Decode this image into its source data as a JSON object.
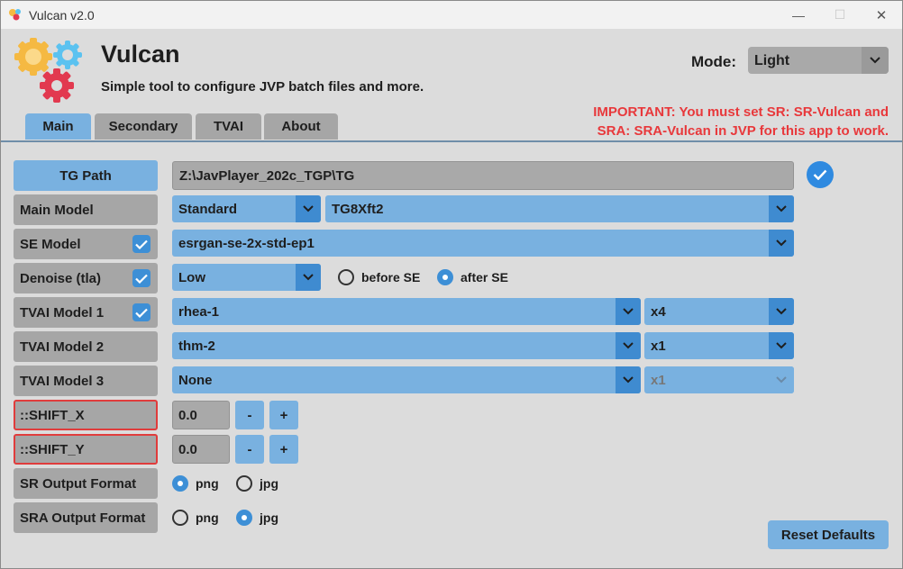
{
  "window": {
    "title": "Vulcan v2.0",
    "minimize": "—",
    "maximize": "☐",
    "close": "✕"
  },
  "header": {
    "app_name": "Vulcan",
    "subtitle": "Simple tool to configure JVP batch files and more.",
    "mode_label": "Mode:",
    "mode_value": "Light",
    "important_line1": "IMPORTANT: You must set SR: SR-Vulcan and",
    "important_line2": "SRA: SRA-Vulcan in JVP for this app to work.",
    "important_color": "#e8383b"
  },
  "tabs": [
    {
      "label": "Main",
      "active": true
    },
    {
      "label": "Secondary",
      "active": false
    },
    {
      "label": "TVAI",
      "active": false
    },
    {
      "label": "About",
      "active": false
    }
  ],
  "main": {
    "tg_path": {
      "label": "TG Path",
      "value": "Z:\\JavPlayer_202c_TGP\\TG",
      "status_icon": "check-circle-icon"
    },
    "main_model": {
      "label": "Main Model",
      "type": "Standard",
      "model": "TG8Xft2"
    },
    "se_model": {
      "label": "SE Model",
      "checked": true,
      "value": "esrgan-se-2x-std-ep1"
    },
    "denoise": {
      "label": "Denoise (tla)",
      "checked": true,
      "value": "Low",
      "before_label": "before SE",
      "after_label": "after SE",
      "selected": "after SE"
    },
    "tvai1": {
      "label": "TVAI Model 1",
      "checked": true,
      "model": "rhea-1",
      "scale": "x4"
    },
    "tvai2": {
      "label": "TVAI Model 2",
      "model": "thm-2",
      "scale": "x1"
    },
    "tvai3": {
      "label": "TVAI Model 3",
      "model": "None",
      "scale": "x1",
      "scale_disabled": true
    },
    "shift_x": {
      "label": "::SHIFT_X",
      "value": "0.0",
      "minus": "-",
      "plus": "+"
    },
    "shift_y": {
      "label": "::SHIFT_Y",
      "value": "0.0",
      "minus": "-",
      "plus": "+"
    },
    "sr_format": {
      "label": "SR Output Format",
      "opt1": "png",
      "opt2": "jpg",
      "selected": "png"
    },
    "sra_format": {
      "label": "SRA Output Format",
      "opt1": "png",
      "opt2": "jpg",
      "selected": "jpg"
    },
    "reset_label": "Reset Defaults"
  },
  "colors": {
    "accent": "#79b1e0",
    "accent_dark": "#3f8bd0",
    "label_bg": "#a6a6a6",
    "error_border": "#e03c3c"
  }
}
